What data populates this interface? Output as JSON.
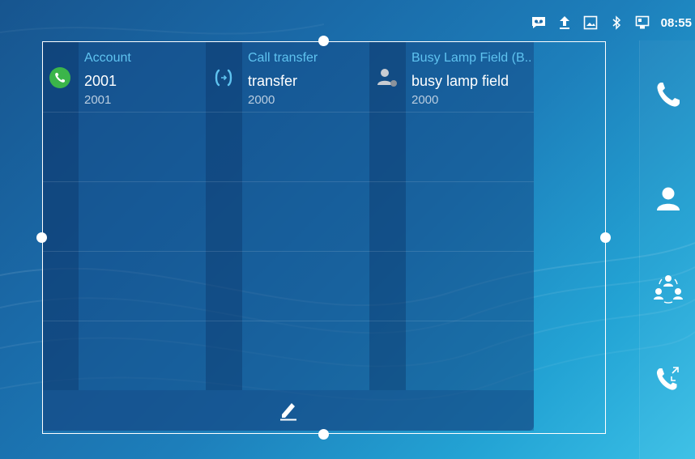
{
  "status_bar": {
    "time": "08:55",
    "icons": [
      "voicemail-icon",
      "upload-icon",
      "image-icon",
      "bluetooth-icon",
      "network-icon"
    ]
  },
  "widget": {
    "cells": [
      {
        "title": "Account",
        "name": "2001",
        "number": "2001",
        "icon": "phone-account-icon",
        "icon_color": "#3bb54a"
      },
      {
        "title": "Call transfer",
        "name": "transfer",
        "number": "2000",
        "icon": "call-transfer-icon",
        "icon_color": "#5fc3f0"
      },
      {
        "title": "Busy Lamp Field (B...",
        "name": "busy lamp field",
        "number": "2000",
        "icon": "blf-contact-icon",
        "icon_color": "#c8ccd2"
      }
    ],
    "edit_icon": "pencil-icon"
  },
  "side_nav": {
    "items": [
      "phone-icon",
      "contacts-icon",
      "conference-icon",
      "call-history-icon"
    ]
  },
  "colors": {
    "accent": "#5fc3f0",
    "account_green": "#3bb54a",
    "text_primary": "#ffffff",
    "text_secondary": "#b9cde0"
  }
}
